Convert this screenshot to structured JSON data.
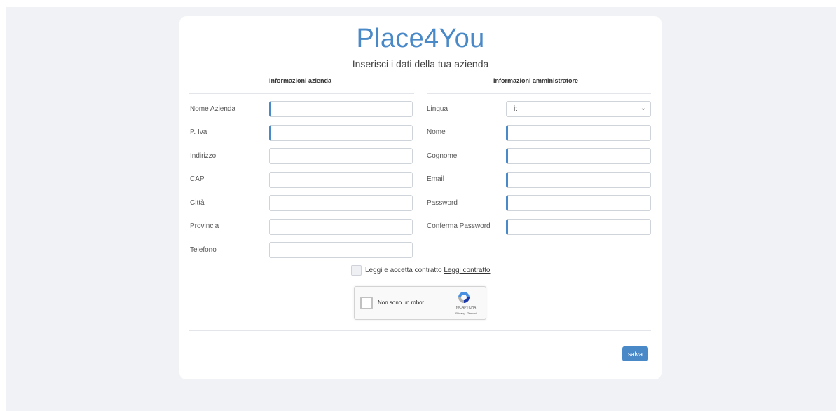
{
  "brand": "Place4You",
  "subtitle": "Inserisci i dati della tua azienda",
  "company": {
    "title": "Informazioni azienda",
    "fields": [
      {
        "label": "Nome Azienda",
        "value": "",
        "required": true
      },
      {
        "label": "P. Iva",
        "value": "",
        "required": true
      },
      {
        "label": "Indirizzo",
        "value": "",
        "required": false
      },
      {
        "label": "CAP",
        "value": "",
        "required": false
      },
      {
        "label": "Città",
        "value": "",
        "required": false
      },
      {
        "label": "Provincia",
        "value": "",
        "required": false
      },
      {
        "label": "Telefono",
        "value": "",
        "required": false
      }
    ]
  },
  "admin": {
    "title": "Informazioni amministratore",
    "language": {
      "label": "Lingua",
      "value": "it"
    },
    "fields": [
      {
        "label": "Nome",
        "value": "",
        "required": true
      },
      {
        "label": "Cognome",
        "value": "",
        "required": true
      },
      {
        "label": "Email",
        "value": "",
        "required": true
      },
      {
        "label": "Password",
        "value": "",
        "required": true
      },
      {
        "label": "Conferma Password",
        "value": "",
        "required": true
      }
    ]
  },
  "terms": {
    "text": "Leggi e accetta contratto",
    "link": "Leggi contratto",
    "checked": false
  },
  "captcha": {
    "label": "Non sono un robot",
    "brand": "reCAPTCHA",
    "links": "Privacy - Termini",
    "checked": false
  },
  "actions": {
    "save": "salva"
  },
  "colors": {
    "accent": "#4a89c8",
    "background": "#f1f2f6"
  }
}
